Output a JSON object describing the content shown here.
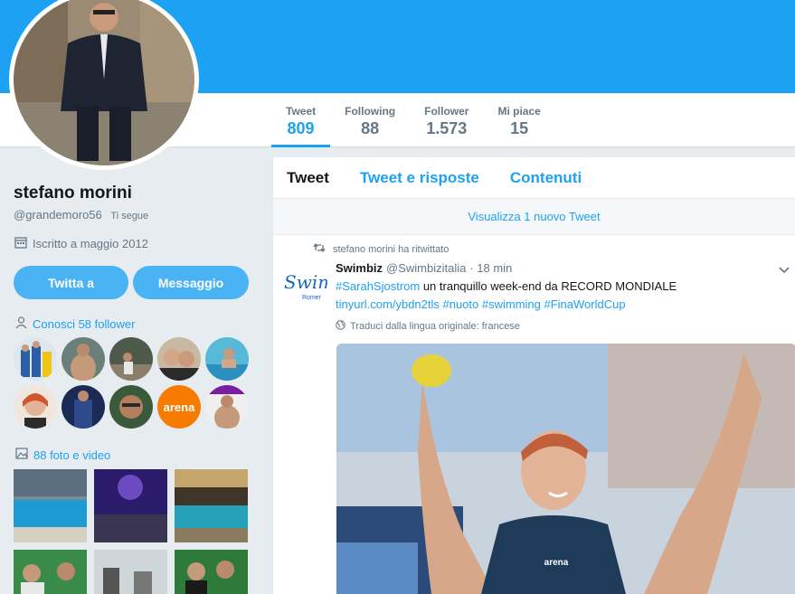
{
  "profile": {
    "name": "stefano morini",
    "handle": "@grandemoro56",
    "follows_you": "Ti segue",
    "joined": "Iscritto a maggio 2012"
  },
  "nav": {
    "stats": [
      {
        "label": "Tweet",
        "value": "809",
        "active": true
      },
      {
        "label": "Following",
        "value": "88"
      },
      {
        "label": "Follower",
        "value": "1.573"
      },
      {
        "label": "Mi piace",
        "value": "15"
      }
    ]
  },
  "actions": {
    "tweet_to": "Twitta a",
    "message": "Messaggio"
  },
  "sidebar": {
    "followers_known": "Conosci 58 follower",
    "media": "88 foto e video"
  },
  "timeline": {
    "tabs": [
      "Tweet",
      "Tweet e risposte",
      "Contenuti"
    ],
    "new_tweets": "Visualizza 1 nuovo Tweet"
  },
  "tweet": {
    "retweet_context": "stefano morini ha ritwittato",
    "author_name": "Swimbiz",
    "author_handle": "@Swimbizitalia",
    "time": "· 18 min",
    "text_hashtag": "#SarahSjostrom",
    "text_body": " un tranquillo week-end da RECORD MONDIALE",
    "text_links": "tinyurl.com/ybdn2tls #nuoto #swimming #FinaWorldCup",
    "translate": "Traduci dalla lingua originale: francese",
    "avatar_logo": "Swim",
    "avatar_sub": "Romer"
  },
  "colors": {
    "accent": "#1da1f2",
    "banner": "#1da1f2",
    "button": "#4ab3f4",
    "background": "#e6ecf0"
  }
}
